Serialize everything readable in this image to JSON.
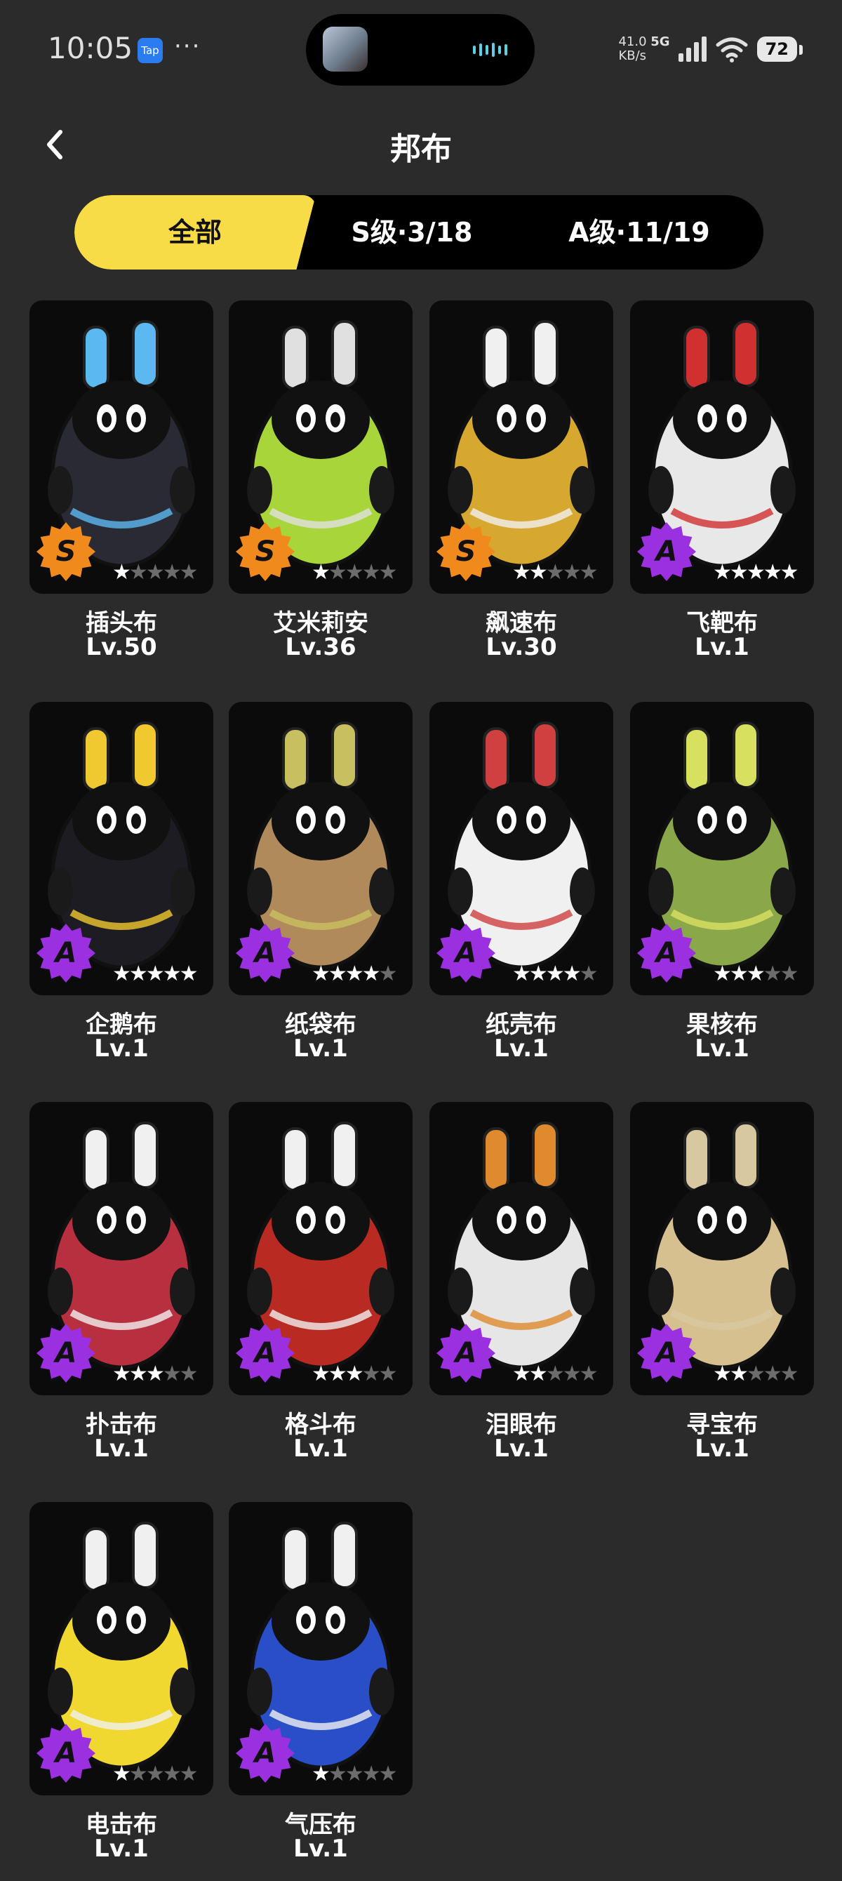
{
  "status_bar": {
    "time": "10:05",
    "tap_badge": "Tap",
    "more": "···",
    "net_speed": "41.0",
    "net_unit": "KB/s",
    "net_type": "5G",
    "battery": "72"
  },
  "header": {
    "title": "邦布",
    "back_icon": "chevron-left-icon"
  },
  "tabs": [
    {
      "label": "全部",
      "active": true
    },
    {
      "label": "S级·3/18",
      "active": false
    },
    {
      "label": "A级·11/19",
      "active": false
    }
  ],
  "colors": {
    "tab_active": "#f7dc47",
    "grade_s": "#f08a1c",
    "grade_a": "#9b30e0",
    "card_bg": "#0b0b0b",
    "page_bg": "#2b2b2b"
  },
  "bangboos": [
    {
      "name": "插头布",
      "level": "Lv.50",
      "grade": "S",
      "stars": 1,
      "body": "#2a2a35",
      "accent": "#5cb8f0"
    },
    {
      "name": "艾米莉安",
      "level": "Lv.36",
      "grade": "S",
      "stars": 1,
      "body": "#a8d63a",
      "accent": "#e0e0e0"
    },
    {
      "name": "飙速布",
      "level": "Lv.30",
      "grade": "S",
      "stars": 2,
      "body": "#d6a830",
      "accent": "#f0f0f0"
    },
    {
      "name": "飞靶布",
      "level": "Lv.1",
      "grade": "A",
      "stars": 5,
      "body": "#e8e8e8",
      "accent": "#d03030"
    },
    {
      "name": "企鹅布",
      "level": "Lv.1",
      "grade": "A",
      "stars": 5,
      "body": "#1c1c22",
      "accent": "#f0c830"
    },
    {
      "name": "纸袋布",
      "level": "Lv.1",
      "grade": "A",
      "stars": 4,
      "body": "#b08a5a",
      "accent": "#c8c060"
    },
    {
      "name": "纸壳布",
      "level": "Lv.1",
      "grade": "A",
      "stars": 4,
      "body": "#f0f0f0",
      "accent": "#d04040"
    },
    {
      "name": "果核布",
      "level": "Lv.1",
      "grade": "A",
      "stars": 3,
      "body": "#8aa84a",
      "accent": "#d8e060"
    },
    {
      "name": "扑击布",
      "level": "Lv.1",
      "grade": "A",
      "stars": 3,
      "body": "#b83040",
      "accent": "#f0f0f0"
    },
    {
      "name": "格斗布",
      "level": "Lv.1",
      "grade": "A",
      "stars": 3,
      "body": "#b82a22",
      "accent": "#f0f0f0"
    },
    {
      "name": "泪眼布",
      "level": "Lv.1",
      "grade": "A",
      "stars": 2,
      "body": "#e6e6e6",
      "accent": "#e08a30"
    },
    {
      "name": "寻宝布",
      "level": "Lv.1",
      "grade": "A",
      "stars": 2,
      "body": "#d6c090",
      "accent": "#d8c8a0"
    },
    {
      "name": "电击布",
      "level": "Lv.1",
      "grade": "A",
      "stars": 1,
      "body": "#f0d830",
      "accent": "#f0f0f0"
    },
    {
      "name": "气压布",
      "level": "Lv.1",
      "grade": "A",
      "stars": 1,
      "body": "#2a4ec8",
      "accent": "#f0f0f0"
    }
  ]
}
